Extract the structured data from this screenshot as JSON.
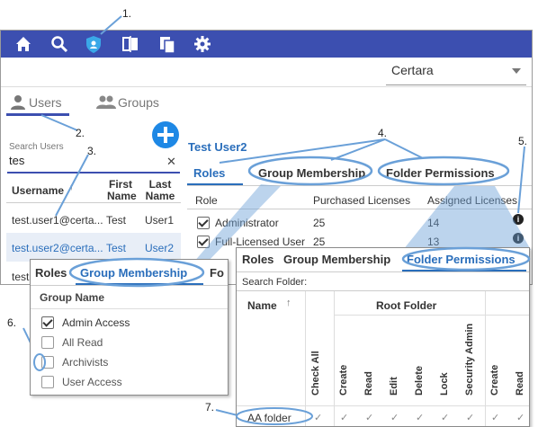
{
  "topbar": {
    "icons": [
      "home-icon",
      "search-icon",
      "shield-icon",
      "compare-icon",
      "documents-icon",
      "gear-icon"
    ],
    "color": "#3c4fb0"
  },
  "tenant": {
    "label": "Certara"
  },
  "left_tabs": {
    "users": "Users",
    "groups": "Groups"
  },
  "search": {
    "label": "Search Users",
    "value": "tes"
  },
  "user_table": {
    "headers": {
      "username": "Username",
      "first": "First Name",
      "last": "Last Name"
    },
    "rows": [
      {
        "username": "test.user1@certa...",
        "first": "Test",
        "last": "User1"
      },
      {
        "username": "test.user2@certa...",
        "first": "Test",
        "last": "User2"
      },
      {
        "username": "test"
      }
    ]
  },
  "detail": {
    "user_name": "Test User2",
    "tabs": {
      "roles": "Roles",
      "groups": "Group Membership",
      "folders": "Folder Permissions"
    },
    "roles_headers": {
      "role": "Role",
      "purchased": "Purchased Licenses",
      "assigned": "Assigned Licenses"
    },
    "roles": [
      {
        "role": "Administrator",
        "purchased": "25",
        "assigned": "14"
      },
      {
        "role": "Full-Licensed User",
        "purchased": "25",
        "assigned": "13"
      }
    ]
  },
  "group_panel": {
    "tabs": {
      "roles": "Roles",
      "groups": "Group Membership",
      "folders": "Fo"
    },
    "header": "Group Name",
    "items": [
      {
        "name": "Admin Access",
        "checked": true
      },
      {
        "name": "All Read",
        "checked": false
      },
      {
        "name": "Archivists",
        "checked": false
      },
      {
        "name": "User Access",
        "checked": false
      }
    ]
  },
  "folder_panel": {
    "tabs": {
      "roles": "Roles",
      "groups": "Group Membership",
      "folders": "Folder Permissions"
    },
    "search_label": "Search Folder:",
    "name_header": "Name",
    "root_header": "Root Folder",
    "perm_columns": [
      "Check All",
      "Create",
      "Read",
      "Edit",
      "Delete",
      "Lock",
      "Security Admin",
      "Create",
      "Read"
    ],
    "row": "AA folder"
  },
  "callouts": [
    "1.",
    "2.",
    "3.",
    "4.",
    "5.",
    "6.",
    "7."
  ]
}
